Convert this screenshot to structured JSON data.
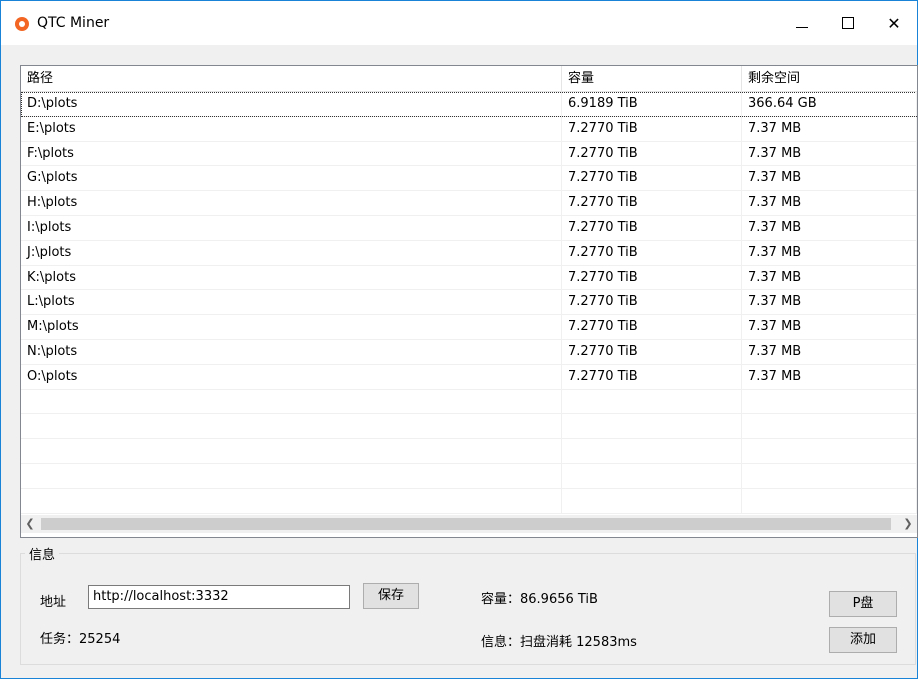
{
  "window": {
    "title": "QTC Miner",
    "accent": "#1883d7",
    "icon_color": "#f26522"
  },
  "grid": {
    "headers": [
      "路径",
      "容量",
      "剩余空间"
    ],
    "rows": [
      [
        "D:\\plots",
        "6.9189 TiB",
        "366.64 GB"
      ],
      [
        "E:\\plots",
        "7.2770 TiB",
        "7.37 MB"
      ],
      [
        "F:\\plots",
        "7.2770 TiB",
        "7.37 MB"
      ],
      [
        "G:\\plots",
        "7.2770 TiB",
        "7.37 MB"
      ],
      [
        "H:\\plots",
        "7.2770 TiB",
        "7.37 MB"
      ],
      [
        "I:\\plots",
        "7.2770 TiB",
        "7.37 MB"
      ],
      [
        "J:\\plots",
        "7.2770 TiB",
        "7.37 MB"
      ],
      [
        "K:\\plots",
        "7.2770 TiB",
        "7.37 MB"
      ],
      [
        "L:\\plots",
        "7.2770 TiB",
        "7.37 MB"
      ],
      [
        "M:\\plots",
        "7.2770 TiB",
        "7.37 MB"
      ],
      [
        "N:\\plots",
        "7.2770 TiB",
        "7.37 MB"
      ],
      [
        "O:\\plots",
        "7.2770 TiB",
        "7.37 MB"
      ]
    ]
  },
  "info": {
    "group_title": "信息",
    "address_label": "地址",
    "address_value": "http://localhost:3332",
    "save_label": "保存",
    "task_text": "任务：25254",
    "capacity_text": "容量：86.9656 TiB",
    "message_text": "信息：扫盘消耗 12583ms",
    "p_button_label": "P盘",
    "add_button_label": "添加"
  }
}
